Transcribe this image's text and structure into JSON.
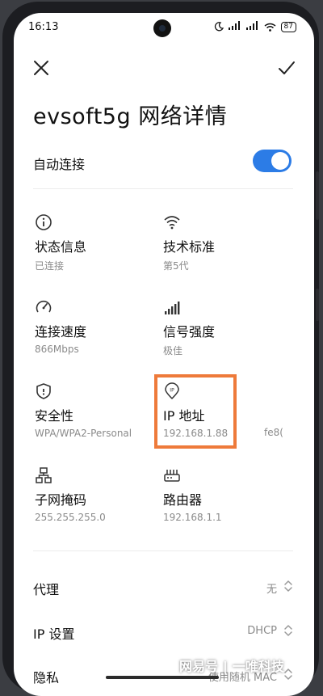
{
  "status_bar": {
    "time": "16:13",
    "signal1": "ᴴᴰ",
    "signal2": "ᴴᴰ",
    "battery": "87"
  },
  "header": {
    "close_icon": "close-icon",
    "confirm_icon": "check-icon"
  },
  "title": "evsoft5g 网络详情",
  "auto_connect": {
    "label": "自动连接",
    "enabled": true,
    "accent": "#2c7ce6"
  },
  "details": [
    {
      "icon": "info-icon",
      "label": "状态信息",
      "value": "已连接"
    },
    {
      "icon": "wifi-icon",
      "label": "技术标准",
      "value": "第5代"
    },
    {
      "icon": "speedometer-icon",
      "label": "连接速度",
      "value": "866Mbps"
    },
    {
      "icon": "signal-bars-icon",
      "label": "信号强度",
      "value": "极佳"
    },
    {
      "icon": "shield-icon",
      "label": "安全性",
      "value": "WPA/WPA2-Personal"
    },
    {
      "icon": "ip-pin-icon",
      "label": "IP 地址",
      "value": "192.168.1.88"
    },
    {
      "icon": "network-nodes-icon",
      "label": "子网掩码",
      "value": "255.255.255.0"
    },
    {
      "icon": "router-icon",
      "label": "路由器",
      "value": "192.168.1.1"
    }
  ],
  "ipv6_partial": "fe8(",
  "highlight_color": "#ee7a3a",
  "settings": [
    {
      "label": "代理",
      "value": "无"
    },
    {
      "label": "IP 设置",
      "value": "DHCP"
    },
    {
      "label": "隐私",
      "value": "使用随机 MAC"
    }
  ],
  "watermark": {
    "left": "网易号",
    "separator": "|",
    "right": "一唯科技"
  }
}
